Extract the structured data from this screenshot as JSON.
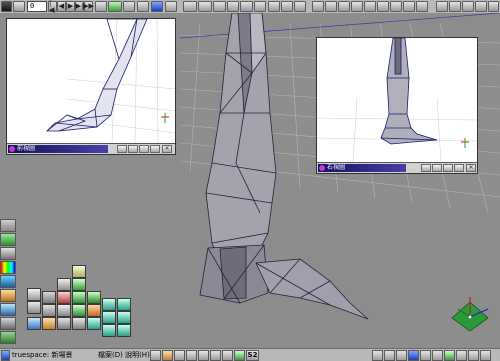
{
  "toolbar": {
    "frame_value": "0",
    "buttons": [
      {
        "name": "rewind-start-button",
        "glyph": "|◀"
      },
      {
        "name": "step-back-button",
        "glyph": "◀"
      },
      {
        "name": "play-button",
        "glyph": "▶"
      },
      {
        "name": "step-forward-button",
        "glyph": "▶|"
      },
      {
        "name": "forward-end-button",
        "glyph": "▶▶"
      },
      {
        "name": "record-button",
        "glyph": "●"
      }
    ]
  },
  "subview_left": {
    "title": "前視圖"
  },
  "subview_right": {
    "title": "右視圖"
  },
  "statusbar": {
    "app_label": "truespace: 新場景",
    "help_label": "檔案(D)  說明(H)",
    "s2_label": "S2"
  },
  "colors": {
    "viewport_bg": "#8d8d8d",
    "wire": "#1a1a6a",
    "title_bar": "#12105a",
    "toolbar_bg": "#b8b8b8"
  }
}
